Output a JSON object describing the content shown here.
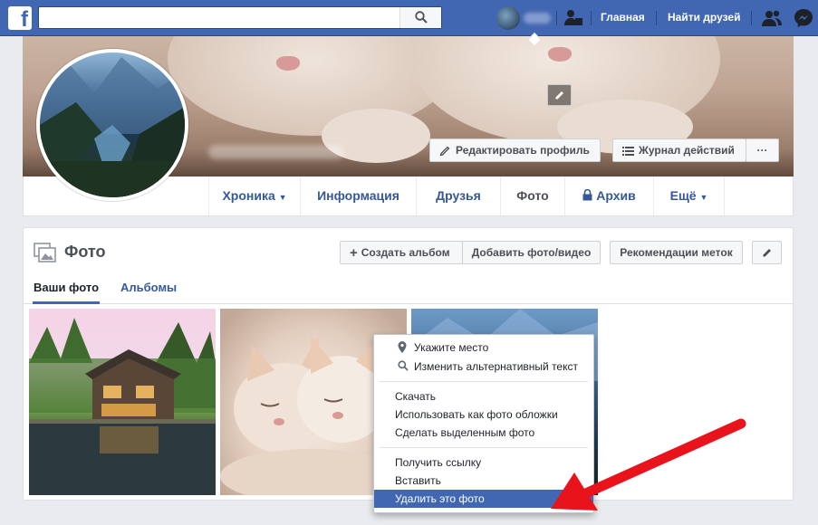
{
  "topbar": {
    "logo_letter": "f",
    "search": {
      "placeholder": "",
      "value": ""
    },
    "nav": {
      "home": "Главная",
      "find_friends": "Найти друзей"
    }
  },
  "profile": {
    "edit_profile": "Редактировать профиль",
    "activity_log": "Журнал действий",
    "more_dots": "···",
    "tabs": [
      {
        "label": "Хроника",
        "dropdown": "▼"
      },
      {
        "label": "Информация"
      },
      {
        "label": "Друзья"
      },
      {
        "label": "Фото"
      },
      {
        "label": "Архив"
      },
      {
        "label": "Ещё",
        "dropdown": "▼"
      }
    ]
  },
  "photos": {
    "title": "Фото",
    "create_album": "Создать альбом",
    "add_photo": "Добавить фото/видео",
    "tag_suggestions": "Рекомендации меток",
    "subtabs": {
      "your_photos": "Ваши фото",
      "albums": "Альбомы"
    }
  },
  "context_menu": {
    "items": [
      {
        "label": "Укажите место",
        "icon": "location-pin-icon"
      },
      {
        "label": "Изменить альтернативный текст",
        "icon": "search-icon"
      },
      {
        "label": "Скачать"
      },
      {
        "label": "Использовать как фото обложки"
      },
      {
        "label": "Сделать выделенным фото"
      },
      {
        "label": "Получить ссылку"
      },
      {
        "label": "Вставить"
      },
      {
        "label": "Удалить это фото",
        "selected": true
      }
    ]
  },
  "colors": {
    "brand": "#4267b2",
    "link": "#365899",
    "highlight_arrow": "#e8131b"
  }
}
